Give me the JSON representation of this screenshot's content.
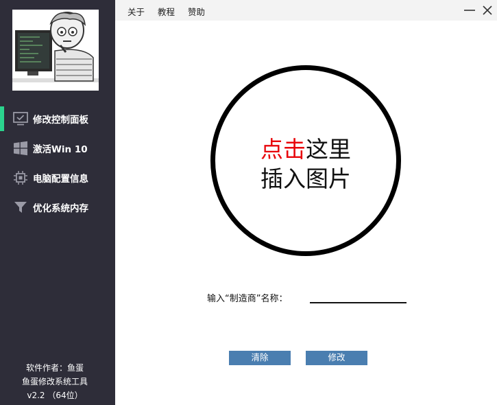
{
  "menu": {
    "about": "关于",
    "tutorial": "教程",
    "donate": "赞助"
  },
  "nav": [
    {
      "label": "修改控制面板",
      "icon": "monitor-check-icon",
      "active": true
    },
    {
      "label": "激活Win 10",
      "icon": "windows-logo-icon",
      "active": false
    },
    {
      "label": "电脑配置信息",
      "icon": "chip-icon",
      "active": false
    },
    {
      "label": "优化系统内存",
      "icon": "funnel-icon",
      "active": false
    }
  ],
  "credits": {
    "author": "软件作者：鱼蛋",
    "app_name": "鱼蛋修改系统工具",
    "version": "v2.2 （64位）"
  },
  "image_picker": {
    "highlight": "点击",
    "rest": "这里",
    "line2": "插入图片"
  },
  "form": {
    "vendor_label": "输入“制造商”名称：",
    "vendor_value": ""
  },
  "buttons": {
    "clear": "清除",
    "modify": "修改"
  },
  "colors": {
    "sidebar": "#2e2d39",
    "active_bar": "#2bd38e",
    "button": "#4a7eb0",
    "highlight": "#e8060b"
  }
}
